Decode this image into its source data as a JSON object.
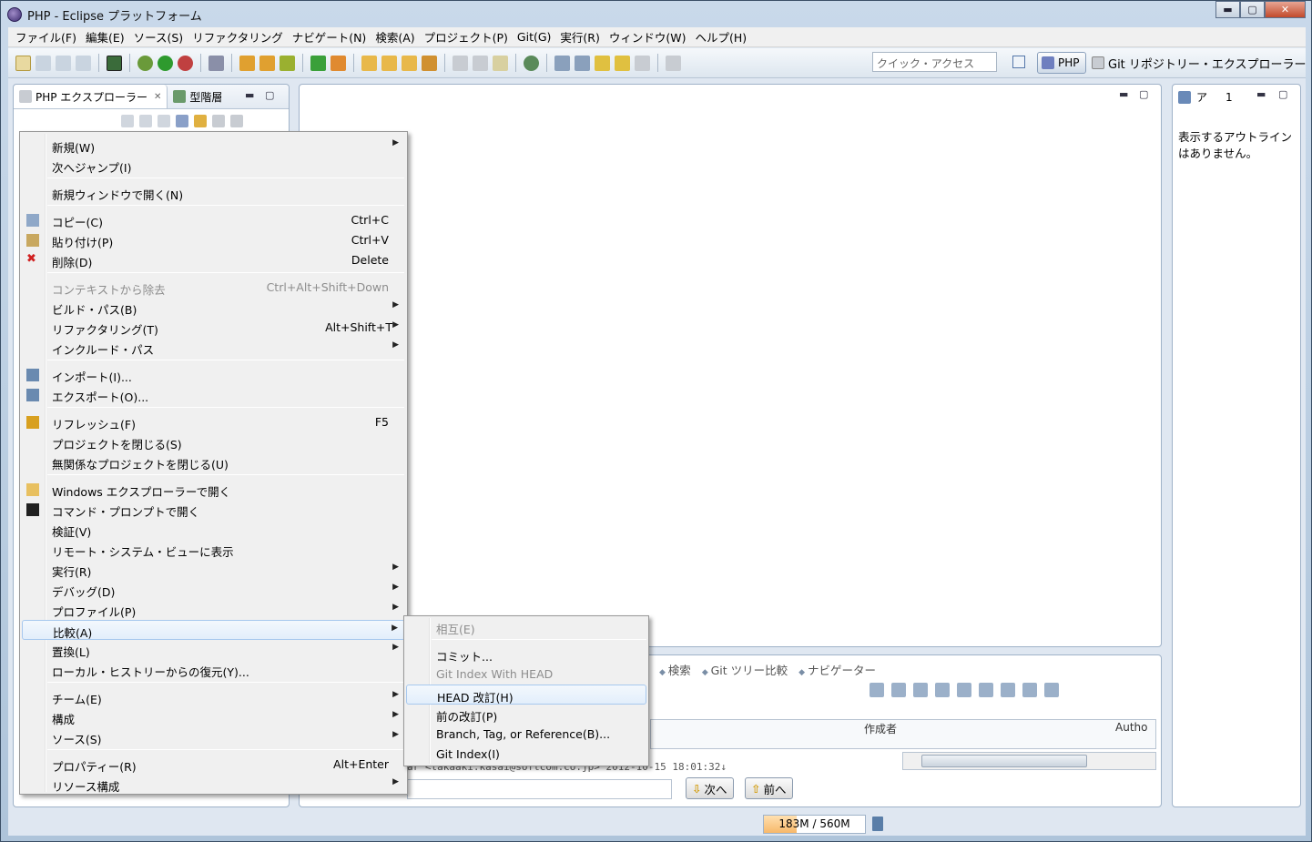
{
  "window": {
    "title": "PHP - Eclipse プラットフォーム",
    "min": "▬",
    "max": "▢",
    "close": "✕"
  },
  "menubar": [
    "ファイル(F)",
    "編集(E)",
    "ソース(S)",
    "リファクタリング",
    "ナビゲート(N)",
    "検索(A)",
    "プロジェクト(P)",
    "Git(G)",
    "実行(R)",
    "ウィンドウ(W)",
    "ヘルプ(H)"
  ],
  "toolbar": {
    "quick_access_placeholder": "クイック・アクセス",
    "perspective_php": "PHP",
    "perspective_git": "Git リポジトリー・エクスプローラー"
  },
  "left_panel": {
    "tab_explorer": "PHP エクスプローラー",
    "tab_hierarchy": "型階層",
    "close": "✕",
    "min": "▬",
    "max": "▢"
  },
  "right_panel": {
    "tab_outline": "ア",
    "tab_count": "1",
    "message": "表示するアウトラインはありません。"
  },
  "bottom_panel": {
    "tabs": [
      "検索",
      "Git ツリー比較",
      "ナビゲーター"
    ],
    "col_author": "作成者",
    "col_author2": "Autho",
    "commit_line": "ar <takaaki.kasai@softcom.co.jp> 2012-10-15 18:01:32↓",
    "next_label": "次へ",
    "prev_label": "前へ"
  },
  "status": {
    "heap": "183M / 560M",
    "heap_used_fraction": 0.327
  },
  "context_menu": {
    "items": [
      {
        "label": "新規(W)",
        "submenu": true
      },
      {
        "label": "次へジャンプ(I)"
      },
      {
        "label": "新規ウィンドウで開く(N)"
      },
      {
        "label": "コピー(C)",
        "shortcut": "Ctrl+C",
        "icon": "copy-icon"
      },
      {
        "label": "貼り付け(P)",
        "shortcut": "Ctrl+V",
        "icon": "paste-icon"
      },
      {
        "label": "削除(D)",
        "shortcut": "Delete",
        "icon": "delete-icon"
      },
      {
        "label": "コンテキストから除去",
        "shortcut": "Ctrl+Alt+Shift+Down",
        "disabled": true
      },
      {
        "label": "ビルド・パス(B)",
        "submenu": true
      },
      {
        "label": "リファクタリング(T)",
        "shortcut": "Alt+Shift+T",
        "submenu": true
      },
      {
        "label": "インクルード・パス",
        "submenu": true
      },
      {
        "label": "インポート(I)...",
        "icon": "import-icon"
      },
      {
        "label": "エクスポート(O)...",
        "icon": "export-icon"
      },
      {
        "label": "リフレッシュ(F)",
        "shortcut": "F5",
        "icon": "refresh-icon"
      },
      {
        "label": "プロジェクトを閉じる(S)"
      },
      {
        "label": "無関係なプロジェクトを閉じる(U)"
      },
      {
        "label": "Windows エクスプローラーで開く",
        "icon": "folder-open-icon"
      },
      {
        "label": "コマンド・プロンプトで開く",
        "icon": "terminal-icon"
      },
      {
        "label": "検証(V)"
      },
      {
        "label": "リモート・システム・ビューに表示"
      },
      {
        "label": "実行(R)",
        "submenu": true
      },
      {
        "label": "デバッグ(D)",
        "submenu": true
      },
      {
        "label": "プロファイル(P)",
        "submenu": true
      },
      {
        "label": "比較(A)",
        "submenu": true,
        "highlighted": true
      },
      {
        "label": "置換(L)",
        "submenu": true
      },
      {
        "label": "ローカル・ヒストリーからの復元(Y)..."
      },
      {
        "label": "チーム(E)",
        "submenu": true
      },
      {
        "label": "構成",
        "submenu": true
      },
      {
        "label": "ソース(S)",
        "submenu": true
      },
      {
        "label": "プロパティー(R)",
        "shortcut": "Alt+Enter"
      },
      {
        "label": "リソース構成",
        "submenu": true
      }
    ],
    "submenu_arrow": "▶"
  },
  "compare_submenu": {
    "items": [
      {
        "label": "相互(E)",
        "disabled": true
      },
      {
        "label": "コミット..."
      },
      {
        "label": "Git Index With HEAD",
        "disabled": true
      },
      {
        "label": "HEAD 改訂(H)",
        "highlighted": true
      },
      {
        "label": "前の改訂(P)"
      },
      {
        "label": "Branch, Tag, or Reference(B)..."
      },
      {
        "label": "Git Index(I)"
      }
    ]
  },
  "colors": {
    "highlight_border": "#a7c8ee",
    "menu_bg": "#f0f0f0",
    "heap_fill": "#f7b86a"
  }
}
